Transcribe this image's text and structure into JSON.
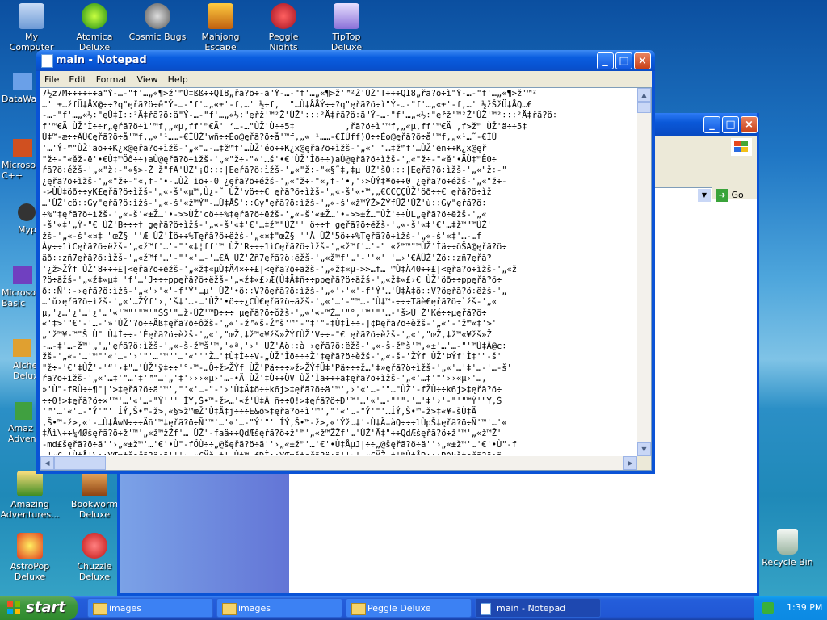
{
  "desktop": {
    "icons": [
      {
        "label": "My Computer",
        "icon": "my-computer-icon"
      },
      {
        "label": "Atomica Deluxe",
        "icon": "atomica-icon"
      },
      {
        "label": "Cosmic Bugs",
        "icon": "cosmic-bugs-icon"
      },
      {
        "label": "Mahjong Escape Anci...",
        "icon": "mahjong-icon"
      },
      {
        "label": "Peggle Nights Deluxe",
        "icon": "peggle-nights-icon"
      },
      {
        "label": "TipTop Deluxe",
        "icon": "tiptop-icon"
      },
      {
        "label": "DataWa",
        "icon": "datawa-icon"
      },
      {
        "label": "Microsoft C++",
        "icon": "visual-cpp-icon"
      },
      {
        "label": "Myp",
        "icon": "myp-icon"
      },
      {
        "label": "Microsoft Basic",
        "icon": "visual-basic-icon"
      },
      {
        "label": "Alche Delux",
        "icon": "alchemy-icon"
      },
      {
        "label": "Amaz Adven",
        "icon": "amazing-icon"
      },
      {
        "label": "Amazing Adventures...",
        "icon": "amazing-adventures-icon"
      },
      {
        "label": "Bookworm Deluxe",
        "icon": "bookworm-icon"
      },
      {
        "label": "AstroPop Deluxe",
        "icon": "astropop-icon"
      },
      {
        "label": "Chuzzle Deluxe",
        "icon": "chuzzle-icon"
      },
      {
        "label": "Recycle Bin",
        "icon": "recycle-bin-icon"
      }
    ]
  },
  "explorer": {
    "go_label": "Go"
  },
  "notepad": {
    "title": "main - Notepad",
    "menu": [
      "File",
      "Edit",
      "Format",
      "View",
      "Help"
    ],
    "lines": [
      "7½z7M÷÷÷÷÷÷ã\"Ý-…-\"f'…„«¶>ž'™Ù‡ßß÷÷QÏ8„řã?ö÷-ä\"Ý-…-\"f'…„«¶>ž'™²Ž'ÙŽ'T÷÷÷QÏ8„řã?ö÷ì\"Ý-…-\"f'…„«¶>ž'™²",
      "…' ±…žfÜ‡ÅX@÷÷?q\"ęřã?ö÷ê\"Ý-…-\"f'…„«±'-f,…' ½÷f,  \"…Ù‡ÅÅÝ÷÷?q\"ęřã?ö÷ì\"Ý-…-\"f'…„«±'-f,…' ½žŠžÜ‡ÅQ…€",
      "-…-\"f'…„«½÷\"ęÙ‡Ì÷÷²Ä‡řã?ö÷ä\"Ý-…-\"f'…„«½÷\"ęřž'™²Ž'ÙŽ'÷÷÷²Ä‡řã?ö÷ä\"Ý-…-\"f'…„«½÷\"ęřž'™²Ž'ÙŽ'™²÷÷÷²Ä‡řã?ö÷",
      "f'™€Ä ÙŽ'Ì÷÷r„ęřã?ö÷ì'™f,„«µ‚ff'™€Ä' ‘…-…\"ÙŽ'Ù÷÷5‡          ,řã?ö÷ì'™f,„«µ‚ff'™€Ä ,f>ž™ ÙŽ'ä÷÷5‡",
      "Ù‡™-æ÷÷ÄÛ€ęřã?ö÷å'™f,„«'¹……-€ÏÙŽ'wñ÷÷Èo@ęřã?ö÷å'™f,„« ¹……-€ÏÙff)Ö÷÷Èo@ęřã?ö÷å'™f,„«¹…˜-€ÏÙ",
      "'…'Ý-™\"ÙŽ'ãö÷÷K¿x@ęřã?ö÷ìžš-'„«\"…-…‡ž™f'…ÙŽ'éö÷÷K¿x@ęřã?ö÷ìžš-'„«' \"…‡ž™f'…ÙŽ'ën÷÷K¿x@ęř",
      "\"ž÷-\"«ěž-ë'•€Ù‡™Öô÷÷)aÙ@ęřã?ö÷ìžš-'„«\"ž÷-\"«'…š'•€'ÙŽ'Ìö÷÷)aÙ@ęřã?ö÷ìžš-'„«\"ž÷-\"«ě'•ÄÙ‡™Ê0÷",
      "řã?ö÷éžš-'„«\"ž÷-\"«§>-Ž ž\"fÄ'ÙŽ'¡Ô÷÷÷|Eęřã?ö÷ìžš-'„«\"ž÷-\"«§˜‡‚‡µ ÙŽ'šÔ÷÷÷|Eęřã?ö÷ìžš-'„«\"ž÷-\"",
      "¿ęřã?ö÷ìžš-'„«\"ž÷-\"«‚f-'•-…ÙŽ'ìö÷-0 ¿ęřã?ö÷éžš-'„«\"ž÷-\"«‚f-'•‚'›>ÙÝ‡¥ö÷÷0 ¿ęřã?ö÷éžš-'„«\"ž÷-",
      "->ÙÙ‡öð÷÷yK£ęřã?ö÷ìžš-'„«-š'«µ™‚Ù¿-˜ ÙŽ'vö÷÷€ ęřã?ö÷ìžš-'„«-š'«•™‚„€CCÇÇÙŽ'öð÷÷€ ęřã?ö÷ìž",
      "…'ÙŽ'cö÷÷Gy\"ęřã?ö÷ìžš-'„«-š'«ž™Ý\"-…Ù‡ÅŠ'÷÷Gy\"ęřã?ö÷ìžš-'„«-š'«ž™ÝŽ>ŽÝfÜŽ'ÙŽ'ù÷÷Gy\"ęřã?ö÷",
      "÷%\"‡ęřã?ö÷ìžš-'„«-š'«±Ž…'•->>ÙŽ'cö÷÷%‡ęřã?ö÷ëžš-'„«-š'«±Ž…'•->>±Ž…\"ÙŽ'÷÷ÜL„ęřã?ö÷ëžš-'„«",
      "-š'«‡'„Ý-\"€ ÙŽ'B÷÷÷† gęřã?ö÷ìžš-'„«-š'«‡'€'…‡ž™\"ÙŽ'' ö÷÷† gęřã?ö÷ëžš-'„«-š'«‡'€'…‡ž™\"™ÙŽ'",
      "žš-'„«-š'«¤‡ \"œŽ§ ''Æ ÙŽ'Ìö÷÷%Tęřã?ö÷ëžš-'„«¤‡\"œŽ§ ''Å ÙŽ'5ö÷÷%Tęřã?ö÷ìžš-'„«-š'«‡'…-…f",
      "Ày÷÷1ìCęřã?ö÷ëžš-'„«ž™f'…'-\"'«‡¦ff'™ ÙŽ'R÷÷÷1ìCęřã?ö÷ìžš-'„«ž™f'…'-\"'«ž™™\"™ÙŽ'Ìä÷÷öŠA@ęřã?ö÷",
      "äð÷÷zñ7ęřã?ö÷ìžš-'„«ž™f'…'-\"'«'…-'…€Ä ÙŽ'Žñ7ęřã?ö÷ëžš-'„«ž™f'…'-\"'«'''…›'€ÄÛŽ'Žö÷÷zñ7ęřã?",
      "'¿ž>ŽÝf ÙŽ'8÷÷÷£|<ęřã?ö÷ëžš-'„«ž‡«µÙ‡Ä4×÷÷£|<ęřã?ö÷ãžš-'„«ž‡«µ->>…f…'™Ù‡Ä40÷÷£|<ęřã?ö÷ìžš-'„«ž",
      "?ö÷ãžš-'„«ž‡«µ‡ 'f'…'J÷÷÷ppęřã?ö÷ëžš-'„«ž‡«£›Æ(Ù‡Ä‡ñ÷÷ppęřã?ö÷äžš-'„«ž‡«£›€ ÙŽ'öð÷÷ppęřã?ö÷",
      "ð÷÷Ñ'÷-›ęřã?ö÷ìžš-'„«'›'«'-f'Ý'…µ' ÙŽ'•ö÷÷V?öęřã?ö÷ìžš-'„«'›'«'-f'Ý'…'Ù‡Ä‡ö÷÷V?öęřã?ö÷ëžš-'„",
      "…'ŭ›ęřã?ö÷ìžš-'„«'…ŽÝf'›‚'š‡'…-…'ÙŽ'•ö÷÷¿CÙ€ęřã?ö÷äžš-'„«'…'-\"™…-\"Ù‡™-÷÷÷Täè€ęřã?ö÷ìžš-'„«",
      "µ‚'¿…'¿'…'¿'…'«'™\"'\"™'\"ŠŠ'\"…ž-ÙŽ'™Ð÷÷÷ µęřã?ö÷ŏžš-'„«'«-™Ž…'\"°‚'™'\"'…-'š>Ù Ž'Ké÷÷µęřã?ö÷",
      "«'‡>'\"€'-'…-'»'ÙŽ'?ö÷÷Äß‡ęřã?ö÷ôžš-'„«'-ž™«š-Ž™š'™'-\"‡'\"-‡Ù‡Ì÷÷-]¢Þęřã?ö÷èžš-'„«'-'ž™«‡'>' ",
      "„'ž™¥-™\"Š Ù\" Ù‡Ì÷÷-'Èęřã?ö÷èžš-'„«',\"œŽ,‡ž™«¥žš»ŽÝfÙŽ'V÷÷-\"€ ęřã?ö÷èžš-'„«',\"œŽ,‡ž™«¥žš»Ž",
      "-…-‡'…-ž™'„'„\"ęřã?ö÷ìžš-'„«-š-ž™š'™,'«ª,'›' ÙŽ'Äö÷÷à ›ęřã?ö÷ëžš-'„«-š-ž™š'™,«±'…'…-\"'™Ù‡Ä@c÷",
      "žš-'„«-'…'™\"'«'…-'›'\"'…'™\"'…'«'''Ž…'‡Ù‡Ì÷÷V-„ÙŽ'Ìö÷÷÷Ž'‡ęřã?ö÷èžš-'„«-š-'ŽÝf ÙŽ'ÞÝf'Ì‡'\"-š'",
      "\"ž÷-'€'‡ÙŽ'-'“'›‡\"…'ÙŽ'ÿ‡÷÷'°-™-…Ô÷ž>ŽÝf ÙŽ'Pä÷÷÷»ž>ŽÝfÜ‡'Pä÷÷÷ž…'‡»ęřã?ö÷ìžš-'„«'…'‡'…-'…-š'",
      "řã?ö÷ìžš-'„«'…‡'\"…'‡'™\"…'„'‡'›››«µ›'…-•Ä ÙŽ'‡Ù÷÷ÖV ÙŽ'Ìä÷÷÷ä‡ęřã?ö÷ìžš-'„«'…‡'\"'››«µ›'…,",
      "»'Ù\"-fRÙ÷÷¶\"|'>‡ęřã?ö÷ä'™',\"'«'…-\"-'›'Ù‡Ä‡ö÷÷k6j>‡ęřã?ö÷ä'™',›'«'…-'\"…\"ÙŽ'-fŽÙ÷÷k6j>‡ęřã?ö÷",
      "÷÷0!>‡ęřã?ö÷×'™'…'«'…-\"Ý'\"' ÍÝ,Š•™-ž>…'«ž'Ù‡Ä ñ÷÷0!>‡ęřã?ö÷Ð'™'…'«'…-\"'\"-'…'‡'›'-\"'\"™Ý'\"Ý,Š",
      "'™'…'«'…-\"Ý'\"' ÍÝ,Š•™-ž>,«§>ž™œŽ'Ù‡Ä‡j÷÷÷E&ö>‡ęřã?ö÷ì'™',\"'«'…-\"Ý'\"'…ÍÝ,Š•™-ž>‡«¥-šÙ‡Ä",
      ",Š•™-ž>,«'-…Ù‡ÅwN÷÷÷Äñ'™‡ęřã?ö÷Ñ'™'…'«'…-\"Ý'\"' ÍÝ,Š•™-ž>,«'Ýž…‡'-Ù‡Ä‡àQ÷÷÷lÙpŠ‡ęřã?ö÷Ñ'™'…'«",
      "‡Äì\\÷÷¼4Øšęřã?ö÷ž'™'„«ž™žŽf'…'ÙŽ'-faä÷÷QdÆšęřã?ö÷ž'™'„«ž™ŽŽf'…'ÙŽ'Ä‡\"÷÷QdÆšęřã?ö÷ž'™'„«ž™Ž'",
      "-md£šęřã?ö÷ä''›„«±ž™'…'€'•Ù\"-fÖÙ÷÷„@šęřã?ö÷ä''›„«±ž™'…'€'•Ù‡ÅµJ|÷÷„@šęřã?ö÷ä''›„«±ž™'…'€'•Ù\"-f",
      "…'«€-'Ù‡Å'\\÷÷¥Œm‡šęřã?ö÷ä'''›„«€Ÿž…‡'-Ù‡™-fÐÌ÷÷¥Œmš‡ęřã?ö÷ä''›'„«€ŸŽ…‡'™Ù‡ÅR÷÷÷R^kš‡ęřã?ö÷ä",
      "->>'''‡ÄÙ'\\|÷÷W7šřã?ö÷ì'™'„«'…Ž…'‡-'-\"…Ù‡'ÿÙ'9÷÷W7šęřã?ö÷ä'™'„«±Ž…'€'…Ù'Ù'0¡÷÷4Ô4ßęřã?ö÷ä'™'„«"
    ]
  },
  "taskbar": {
    "start_label": "start",
    "tasks": [
      {
        "label": "images",
        "icon": "folder-icon"
      },
      {
        "label": "images",
        "icon": "folder-icon"
      },
      {
        "label": "Peggle Deluxe",
        "icon": "folder-icon"
      },
      {
        "label": "main - Notepad",
        "icon": "notepad-icon"
      }
    ],
    "clock": "1:39 PM"
  },
  "colors": {
    "titlebar_blue": "#0a53d6",
    "taskbar_blue": "#245edb",
    "start_green": "#3d963b"
  }
}
